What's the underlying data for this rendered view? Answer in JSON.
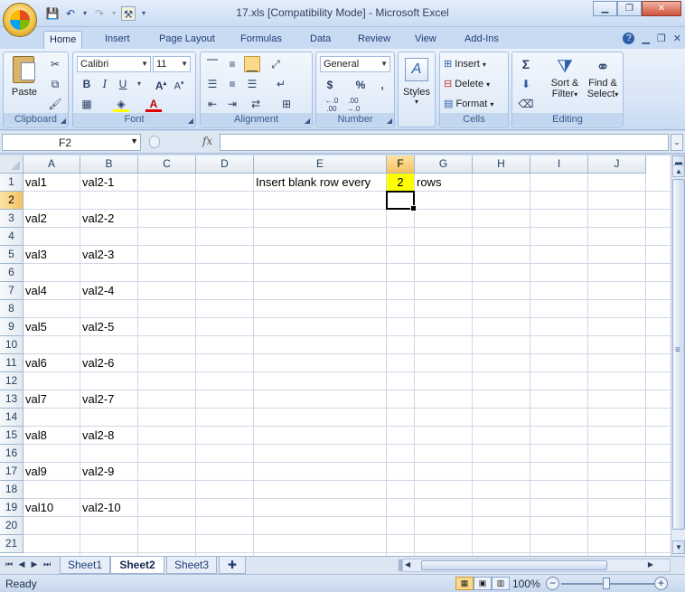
{
  "window": {
    "title": "17.xls  [Compatibility Mode] - Microsoft Excel",
    "controls": [
      "minimize",
      "restore",
      "close"
    ]
  },
  "ribbon": {
    "tabs": [
      "Home",
      "Insert",
      "Page Layout",
      "Formulas",
      "Data",
      "Review",
      "View",
      "Add-Ins"
    ],
    "active_tab": "Home",
    "clipboard": {
      "paste_label": "Paste",
      "group_label": "Clipboard"
    },
    "font": {
      "family": "Calibri",
      "size": "11",
      "group_label": "Font"
    },
    "alignment": {
      "group_label": "Alignment"
    },
    "number": {
      "format": "General",
      "currency": "$",
      "percent": "%",
      "comma": ",",
      "group_label": "Number"
    },
    "styles": {
      "label": "Styles"
    },
    "cells": {
      "insert": "Insert",
      "delete": "Delete",
      "format": "Format",
      "group_label": "Cells"
    },
    "editing": {
      "sum": "Σ",
      "sort_filter_1": "Sort &",
      "sort_filter_2": "Filter",
      "find_select_1": "Find &",
      "find_select_2": "Select",
      "group_label": "Editing"
    }
  },
  "formula_bar": {
    "name_box": "F2",
    "fx": "fx",
    "value": ""
  },
  "grid": {
    "columns": [
      "A",
      "B",
      "C",
      "D",
      "E",
      "F",
      "G",
      "H",
      "I",
      "J"
    ],
    "rows": [
      "1",
      "2",
      "3",
      "4",
      "5",
      "6",
      "7",
      "8",
      "9",
      "10",
      "11",
      "12",
      "13",
      "14",
      "15",
      "16",
      "17",
      "18",
      "19",
      "20",
      "21"
    ],
    "selected_cell": "F2",
    "cells": {
      "A1": "val1",
      "B1": "val2-1",
      "A3": "val2",
      "B3": "val2-2",
      "A5": "val3",
      "B5": "val2-3",
      "A7": "val4",
      "B7": "val2-4",
      "A9": "val5",
      "B9": "val2-5",
      "A11": "val6",
      "B11": "val2-6",
      "A13": "val7",
      "B13": "val2-7",
      "A15": "val8",
      "B15": "val2-8",
      "A17": "val9",
      "B17": "val2-9",
      "A19": "val10",
      "B19": "val2-10",
      "E1": "Insert blank row every",
      "F1": "2",
      "G1": "rows"
    },
    "highlight_color": "#ffff00"
  },
  "sheets": {
    "tabs": [
      "Sheet1",
      "Sheet2",
      "Sheet3"
    ],
    "active": "Sheet2"
  },
  "status": {
    "text": "Ready",
    "zoom": "100%"
  }
}
